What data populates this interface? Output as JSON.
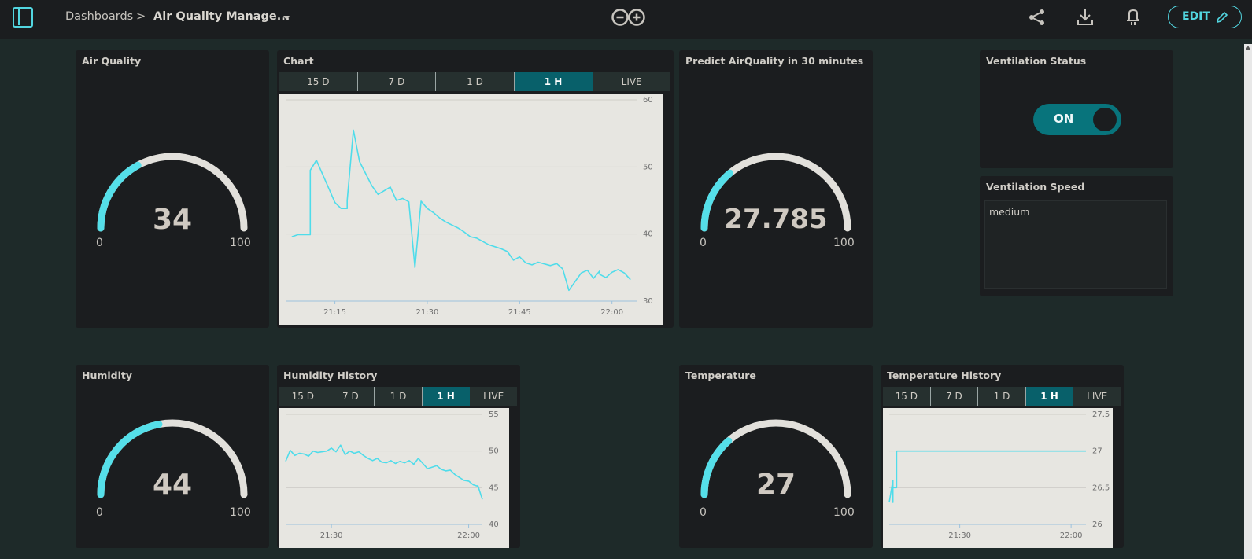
{
  "header": {
    "breadcrumb_root": "Dashboards",
    "breadcrumb_separator": ">",
    "dashboard_name": "Air Quality Manage...",
    "edit_label": "EDIT",
    "icons": [
      "sidebar-toggle-icon",
      "chevron-down-icon",
      "arduino-logo",
      "share-icon",
      "download-icon",
      "mobile-notify-icon",
      "pencil-icon"
    ],
    "accent_color": "#52d6e0"
  },
  "timeframes": [
    "15 D",
    "7 D",
    "1 D",
    "1 H",
    "LIVE"
  ],
  "active_timeframe": "1 H",
  "widgets": {
    "air_quality": {
      "title": "Air Quality",
      "value": "34",
      "min": "0",
      "max": "100",
      "fraction": 0.34
    },
    "chart": {
      "title": "Chart",
      "y_ticks": [
        "60",
        "50",
        "40",
        "30"
      ],
      "x_ticks": [
        "21:15",
        "21:30",
        "21:45",
        "22:00"
      ]
    },
    "predict": {
      "title": "Predict AirQuality in 30 minutes",
      "value": "27.785",
      "min": "0",
      "max": "100",
      "fraction": 0.278
    },
    "ventilation_status": {
      "title": "Ventilation Status",
      "label": "ON",
      "on": true
    },
    "ventilation_speed": {
      "title": "Ventilation Speed",
      "value": "medium"
    },
    "humidity": {
      "title": "Humidity",
      "value": "44",
      "min": "0",
      "max": "100",
      "fraction": 0.44
    },
    "humidity_history": {
      "title": "Humidity History",
      "y_ticks": [
        "55",
        "50",
        "45",
        "40"
      ],
      "x_ticks": [
        "21:30",
        "22:00"
      ]
    },
    "temperature": {
      "title": "Temperature",
      "value": "27",
      "min": "0",
      "max": "100",
      "fraction": 0.27
    },
    "temperature_history": {
      "title": "Temperature History",
      "y_ticks": [
        "27.5",
        "27",
        "26.5",
        "26"
      ],
      "x_ticks": [
        "21:30",
        "22:00"
      ]
    }
  },
  "chart_data": [
    {
      "type": "line",
      "x_domain": [
        "21:07",
        "22:04"
      ],
      "ylim": [
        30,
        60
      ],
      "series": [
        {
          "x": [
            "21:08",
            "21:09",
            "21:11",
            "21:11",
            "21:12",
            "21:14",
            "21:15",
            "21:16",
            "21:17",
            "21:17",
            "21:18",
            "21:19",
            "21:20",
            "21:21",
            "21:22",
            "21:24",
            "21:25",
            "21:26",
            "21:27",
            "21:28",
            "21:29",
            "21:30",
            "21:31",
            "21:32",
            "21:33",
            "21:35",
            "21:36",
            "21:37",
            "21:38",
            "21:39",
            "21:40",
            "21:42",
            "21:43",
            "21:44",
            "21:45",
            "21:46",
            "21:47",
            "21:48",
            "21:50",
            "21:51",
            "21:52",
            "21:53",
            "21:55",
            "21:56",
            "21:57",
            "21:58",
            "21:58",
            "21:59",
            "22:00",
            "22:01",
            "22:02",
            "22:03"
          ],
          "values": [
            39.6,
            39.9,
            39.9,
            49.5,
            51.0,
            46.8,
            44.7,
            43.8,
            43.8,
            45.0,
            55.5,
            50.8,
            49.0,
            47.2,
            45.9,
            47.0,
            45.0,
            45.3,
            44.8,
            35.0,
            44.9,
            43.8,
            43.2,
            42.4,
            41.8,
            40.9,
            40.3,
            39.6,
            39.4,
            38.9,
            38.4,
            37.8,
            37.4,
            36.1,
            36.6,
            35.7,
            35.4,
            35.8,
            35.3,
            35.6,
            34.8,
            31.6,
            34.2,
            34.6,
            33.4,
            34.5,
            34.0,
            33.5,
            34.3,
            34.7,
            34.2,
            33.2
          ]
        }
      ]
    },
    {
      "type": "line",
      "x_domain": [
        "21:20",
        "22:03"
      ],
      "ylim": [
        40,
        55
      ],
      "series": [
        {
          "x": [
            "21:20",
            "21:21",
            "21:22",
            "21:23",
            "21:24",
            "21:25",
            "21:26",
            "21:27",
            "21:28",
            "21:29",
            "21:30",
            "21:31",
            "21:32",
            "21:33",
            "21:34",
            "21:35",
            "21:36",
            "21:37",
            "21:38",
            "21:39",
            "21:40",
            "21:41",
            "21:42",
            "21:43",
            "21:44",
            "21:45",
            "21:46",
            "21:47",
            "21:48",
            "21:49",
            "21:50",
            "21:51",
            "21:52",
            "21:53",
            "21:54",
            "21:55",
            "21:56",
            "21:57",
            "21:58",
            "21:59",
            "22:00",
            "22:01",
            "22:02",
            "22:02",
            "22:03"
          ],
          "values": [
            48.6,
            50.1,
            49.4,
            49.7,
            49.6,
            49.3,
            50.0,
            49.8,
            49.9,
            50.0,
            50.4,
            49.9,
            50.8,
            49.5,
            50.0,
            49.7,
            49.9,
            49.4,
            49.0,
            48.7,
            49.0,
            48.5,
            48.4,
            48.7,
            48.3,
            48.6,
            48.4,
            48.7,
            48.2,
            49.0,
            48.3,
            47.6,
            47.8,
            48.0,
            47.5,
            47.3,
            47.4,
            46.8,
            46.4,
            46.0,
            45.9,
            45.4,
            45.2,
            45.3,
            43.4
          ]
        }
      ]
    },
    {
      "type": "line",
      "x_domain": [
        "21:11",
        "22:04"
      ],
      "ylim": [
        26,
        27.5
      ],
      "series": [
        {
          "x": [
            "21:11",
            "21:12",
            "21:12",
            "21:12",
            "21:12",
            "21:13",
            "21:13",
            "22:04"
          ],
          "values": [
            26.3,
            26.6,
            26.3,
            26.4,
            26.5,
            26.5,
            27.0,
            27.0
          ]
        }
      ]
    }
  ]
}
